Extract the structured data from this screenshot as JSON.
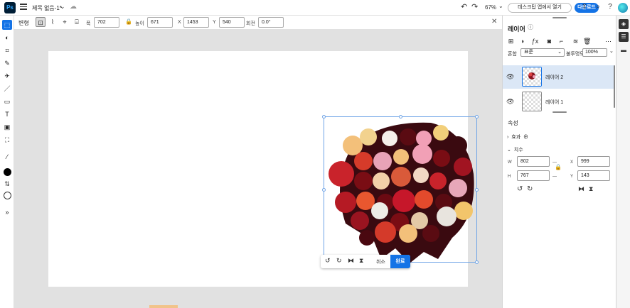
{
  "app": {
    "logo": "Ps",
    "title": "제목 없음-1*",
    "zoom": "67%",
    "desktop_btn": "데스크탑 앱에서 열기",
    "download_btn": "다운로드"
  },
  "options": {
    "title": "변형",
    "width_label": "폭",
    "width_value": "702",
    "height_label": "높이",
    "height_value": "671",
    "x_label": "X",
    "x_value": "1453",
    "y_label": "Y",
    "y_value": "540",
    "rotate_label": "회전",
    "rotate_value": "0.0°"
  },
  "floatbar": {
    "cancel": "취소",
    "done": "완료"
  },
  "layers_panel": {
    "title": "레이어",
    "blend_label": "혼합",
    "blend_value": "표준",
    "opacity_label": "불투명도",
    "opacity_value": "100%",
    "layers": [
      {
        "name": "레이어 2",
        "selected": true
      },
      {
        "name": "레이어 1",
        "selected": false
      }
    ]
  },
  "properties": {
    "title": "속성",
    "effects_label": "효과",
    "dimensions_label": "치수",
    "w_label": "W",
    "w_value": "802",
    "x_label": "X",
    "x_value": "999",
    "h_label": "H",
    "h_value": "767",
    "y_label": "Y",
    "y_value": "143"
  },
  "icons": {
    "menu": "menu-icon",
    "cloud": "cloud-icon",
    "undo": "undo-icon",
    "redo": "redo-icon",
    "share": "share-icon",
    "search": "search-icon",
    "help": "help-icon",
    "lock": "lock-icon",
    "close": "close-icon",
    "eye": "eye-icon"
  },
  "colors": {
    "accent": "#1473e6",
    "foreground": "#000000",
    "background": "#ffffff"
  }
}
